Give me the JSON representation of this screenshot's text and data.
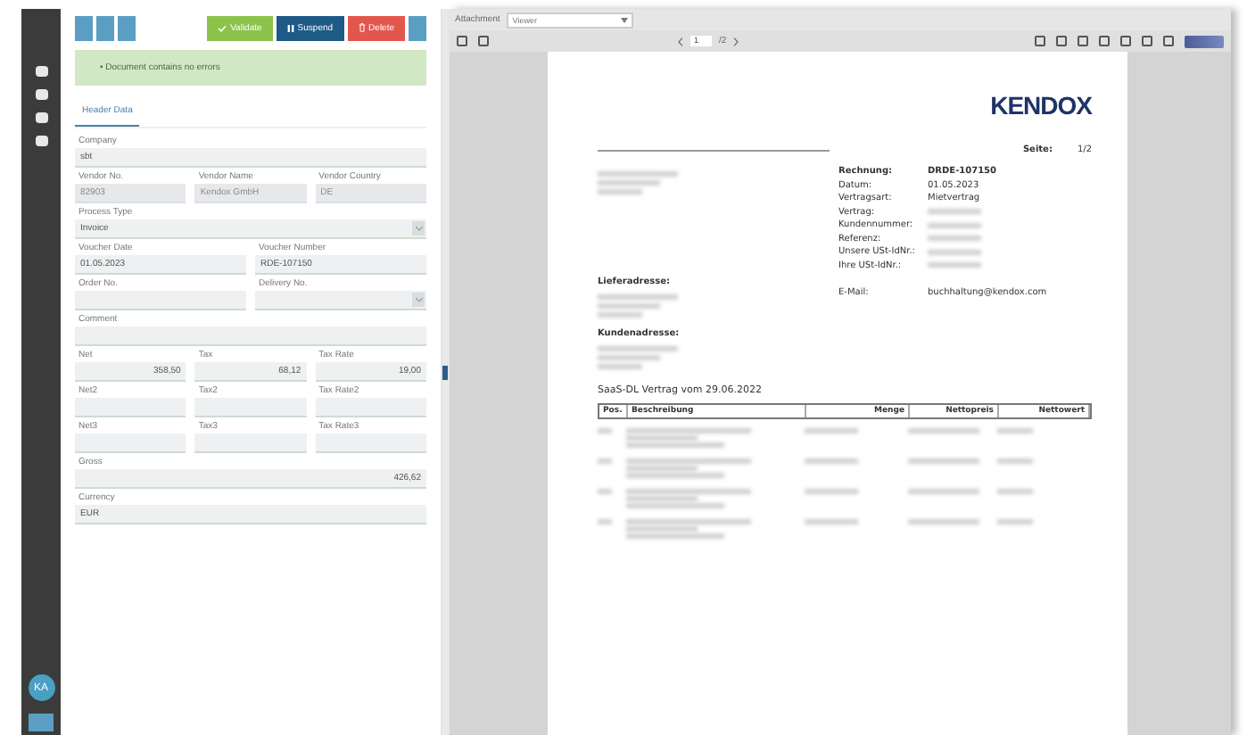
{
  "sidebar": {
    "avatar": "KA"
  },
  "toolbar": {
    "buttons": [
      {
        "label": "Validate",
        "kind": "validate"
      },
      {
        "label": "Suspend",
        "kind": "suspend"
      },
      {
        "label": "Delete",
        "kind": "delete"
      }
    ]
  },
  "alert": "• Document contains no errors",
  "tabs": [
    {
      "label": "Header Data",
      "selected": true
    }
  ],
  "form": {
    "rows": [
      [
        {
          "label": "Company",
          "value": "sbt",
          "kind": "text",
          "disabled": false
        }
      ],
      [
        {
          "label": "Vendor No.",
          "value": "82903",
          "kind": "text",
          "disabled": true
        },
        {
          "label": "Vendor Name",
          "value": "Kendox GmbH",
          "kind": "text",
          "disabled": true
        },
        {
          "label": "Vendor Country",
          "value": "DE",
          "kind": "text",
          "disabled": true
        }
      ],
      [
        {
          "label": "Process Type",
          "value": "Invoice",
          "kind": "select",
          "disabled": false
        }
      ],
      [
        {
          "label": "Voucher Date",
          "value": "01.05.2023",
          "kind": "text",
          "disabled": false
        },
        {
          "label": "Voucher Number",
          "value": "RDE-107150",
          "kind": "text",
          "disabled": false
        }
      ],
      [
        {
          "label": "Order No.",
          "kind": "text",
          "disabled": false
        },
        {
          "label": "Delivery No.",
          "kind": "select",
          "disabled": false
        }
      ],
      [
        {
          "label": "Comment",
          "kind": "text",
          "disabled": false
        }
      ],
      [
        {
          "label": "Net",
          "value": "358,50",
          "kind": "number",
          "disabled": false
        },
        {
          "label": "Tax",
          "value": "68,12",
          "kind": "number",
          "disabled": false
        },
        {
          "label": "Tax Rate",
          "value": "19,00",
          "kind": "number",
          "disabled": false
        }
      ],
      [
        {
          "label": "Net2",
          "kind": "number",
          "disabled": false
        },
        {
          "label": "Tax2",
          "kind": "number",
          "disabled": false
        },
        {
          "label": "Tax Rate2",
          "kind": "number",
          "disabled": false
        }
      ],
      [
        {
          "label": "Net3",
          "kind": "number",
          "disabled": false
        },
        {
          "label": "Tax3",
          "kind": "number",
          "disabled": false
        },
        {
          "label": "Tax Rate3",
          "kind": "number",
          "disabled": false
        }
      ],
      [
        {
          "label": "Gross",
          "value": "426,62",
          "kind": "number",
          "disabled": false
        }
      ],
      [
        {
          "label": "Currency",
          "value": "EUR",
          "kind": "text",
          "disabled": false
        }
      ]
    ]
  },
  "viewer": {
    "attachment_label": "Attachment",
    "attachment_value": "Viewer",
    "page": "1",
    "page_total": "/2"
  },
  "document": {
    "logo": "KENDOX",
    "page_label": "Seite:",
    "page_value": "1/2",
    "info": [
      {
        "label": "Rechnung:",
        "value": "DRDE-107150",
        "bold": true,
        "redacted": false
      },
      {
        "label": "Datum:",
        "value": "01.05.2023",
        "bold": false,
        "redacted": false
      },
      {
        "label": "Vertragsart:",
        "value": "Mietvertrag",
        "bold": false,
        "redacted": false
      },
      {
        "label": "Vertrag:",
        "bold": false,
        "redacted": true
      },
      {
        "label": "Kundennummer:",
        "bold": false,
        "redacted": true
      },
      {
        "label": "Referenz:",
        "bold": false,
        "redacted": true
      },
      {
        "label": "Unsere USt-IdNr.:",
        "bold": false,
        "redacted": true
      },
      {
        "label": "Ihre USt-IdNr.:",
        "bold": false,
        "redacted": true
      }
    ],
    "email_label": "E-Mail:",
    "email": "buchhaltung@kendox.com",
    "delivery_heading": "Lieferadresse:",
    "customer_heading": "Kundenadresse:",
    "subject": "SaaS-DL Vertrag vom 29.06.2022",
    "columns": [
      "Pos.",
      "Beschreibung",
      "Menge",
      "Nettopreis",
      "Nettowert"
    ]
  }
}
